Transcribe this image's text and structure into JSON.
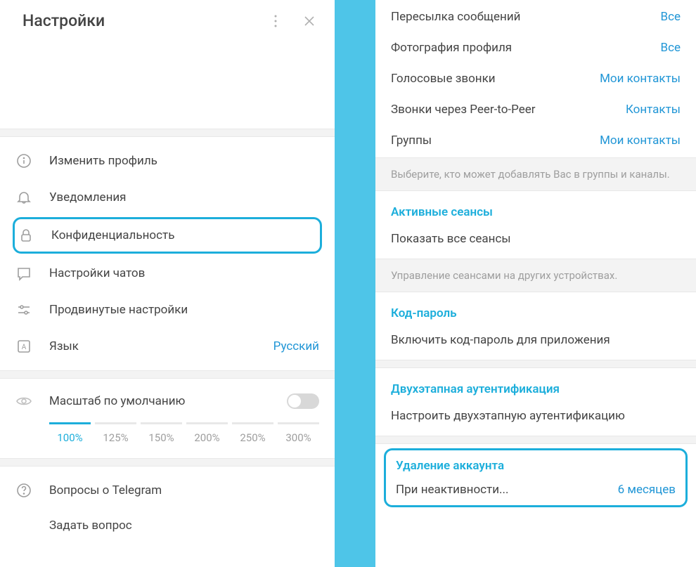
{
  "left": {
    "title": "Настройки",
    "menu": {
      "edit_profile": "Изменить профиль",
      "notifications": "Уведомления",
      "privacy": "Конфиденциальность",
      "chat_settings": "Настройки чатов",
      "advanced": "Продвинутые настройки",
      "language": "Язык",
      "language_value": "Русский"
    },
    "scale": {
      "label": "Масштаб по умолчанию",
      "options": [
        "100%",
        "125%",
        "150%",
        "200%",
        "250%",
        "300%"
      ]
    },
    "help": {
      "telegram_faq": "Вопросы о Telegram",
      "ask_question": "Задать вопрос"
    }
  },
  "right": {
    "privacy_rows": [
      {
        "label": "Пересылка сообщений",
        "value": "Все"
      },
      {
        "label": "Фотография профиля",
        "value": "Все"
      },
      {
        "label": "Голосовые звонки",
        "value": "Мои контакты"
      },
      {
        "label": "Звонки через Peer-to-Peer",
        "value": "Контакты"
      },
      {
        "label": "Группы",
        "value": "Мои контакты"
      }
    ],
    "groups_hint": "Выберите, кто может добавлять Вас в группы и каналы.",
    "sessions": {
      "header": "Активные сеансы",
      "show_all": "Показать все сеансы",
      "hint": "Управление сеансами на других устройствах."
    },
    "passcode": {
      "header": "Код-пароль",
      "enable": "Включить код-пароль для приложения"
    },
    "two_step": {
      "header": "Двухэтапная аутентификация",
      "setup": "Настроить двухэтапную аутентификацию"
    },
    "delete_account": {
      "header": "Удаление аккаунта",
      "inactive_label": "При неактивности...",
      "inactive_value": "6 месяцев"
    }
  }
}
